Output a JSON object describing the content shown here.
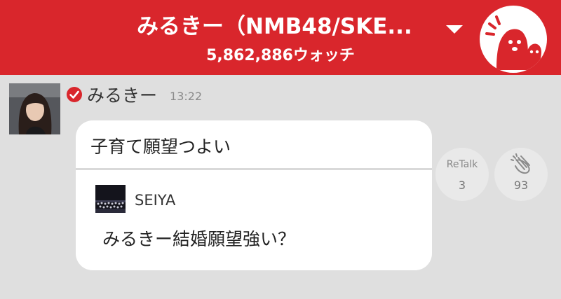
{
  "header": {
    "title": "みるきー（NMB48/SKE...",
    "watch_count": "5,862,886ウォッチ",
    "accent_color": "#d9262c",
    "dropdown_icon": "chevron-down-icon",
    "logo_icon": "ghost-mascot-logo"
  },
  "post": {
    "author": "みるきー",
    "verified_icon": "verified-check-icon",
    "time": "13:22",
    "text": "子育て願望つよい",
    "quote": {
      "author": "SEIYA",
      "text": "みるきー結婚願望強い？"
    }
  },
  "actions": {
    "retalk_label": "ReTalk",
    "retalk_count": "3",
    "clap_icon": "clapping-hands-icon",
    "clap_count": "93"
  }
}
